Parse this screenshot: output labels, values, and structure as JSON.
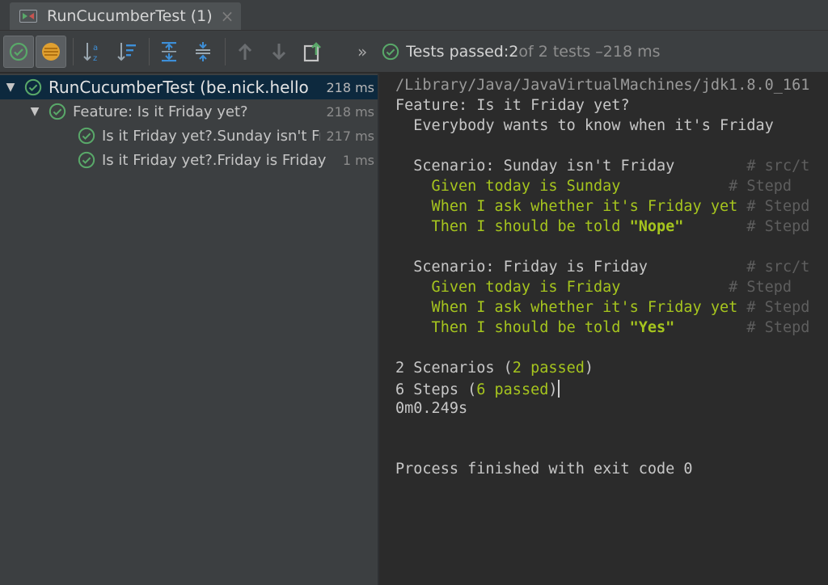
{
  "tab": {
    "title": "RunCucumberTest (1)",
    "close": "×"
  },
  "toolbar": {
    "more": "»",
    "status": {
      "prefix": "Tests passed: ",
      "passed": "2",
      "middle": " of 2 tests – ",
      "duration": "218 ms"
    }
  },
  "tree": {
    "rows": [
      {
        "label": "RunCucumberTest (be.nick.hello",
        "time": "218 ms"
      },
      {
        "label": "Feature: Is it Friday yet?",
        "time": "218 ms"
      },
      {
        "label": "Is it Friday yet?.Sunday isn't Friday",
        "time": "217 ms"
      },
      {
        "label": "Is it Friday yet?.Friday is Friday",
        "time": "1 ms"
      }
    ]
  },
  "console": {
    "path": "/Library/Java/JavaVirtualMachines/jdk1.8.0_161",
    "feature": "Feature: Is it Friday yet?",
    "description": "  Everybody wants to know when it's Friday",
    "scenario1": {
      "title": "  Scenario: Sunday isn't Friday        ",
      "comment": "# src/t",
      "given": "    Given today is Sunday",
      "given_comment": "            # Stepd",
      "when": "    When I ask whether it's Friday yet",
      "when_comment": " # Stepd",
      "then": "    Then I should be told ",
      "then_arg": "\"Nope\"",
      "then_comment": "       # Stepd"
    },
    "scenario2": {
      "title": "  Scenario: Friday is Friday           ",
      "comment": "# src/t",
      "given": "    Given today is Friday",
      "given_comment": "            # Stepd",
      "when": "    When I ask whether it's Friday yet",
      "when_comment": " # Stepd",
      "then": "    Then I should be told ",
      "then_arg": "\"Yes\"",
      "then_comment": "        # Stepd"
    },
    "scenarios_summary": {
      "prefix": "2 Scenarios (",
      "passed": "2 passed",
      "suffix": ")"
    },
    "steps_summary": {
      "prefix": "6 Steps (",
      "passed": "6 passed",
      "suffix": ")"
    },
    "elapsed": "0m0.249s",
    "exit": "Process finished with exit code 0"
  },
  "colors": {
    "pass_green": "#59a869",
    "step_green": "#a6c51e",
    "selected_row": "#0d293e"
  },
  "icons": [
    "run-tool-icon",
    "show-passed-icon",
    "show-ignored-icon",
    "sort-alpha-icon",
    "sort-duration-icon",
    "expand-all-icon",
    "collapse-all-icon",
    "prev-failed-icon",
    "next-failed-icon",
    "export-icon",
    "passed-check-icon"
  ]
}
